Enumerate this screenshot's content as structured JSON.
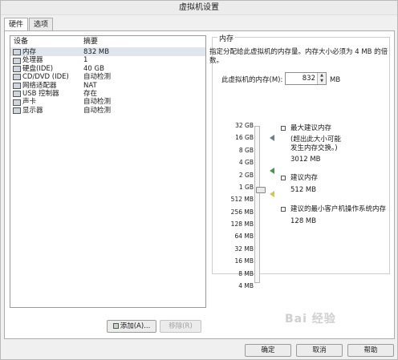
{
  "window": {
    "title": "虚拟机设置"
  },
  "tabs": [
    {
      "label": "硬件"
    },
    {
      "label": "选项"
    }
  ],
  "device_list": {
    "headers": {
      "device": "设备",
      "summary": "摘要"
    },
    "rows": [
      {
        "device": "内存",
        "summary": "832 MB",
        "icon": "memory-icon"
      },
      {
        "device": "处理器",
        "summary": "1",
        "icon": "processor-icon"
      },
      {
        "device": "硬盘(IDE)",
        "summary": "40 GB",
        "icon": "hard-disk-icon"
      },
      {
        "device": "CD/DVD (IDE)",
        "summary": "自动检测",
        "icon": "cd-dvd-icon"
      },
      {
        "device": "网络适配器",
        "summary": "NAT",
        "icon": "network-adapter-icon"
      },
      {
        "device": "USB 控制器",
        "summary": "存在",
        "icon": "usb-controller-icon"
      },
      {
        "device": "声卡",
        "summary": "自动检测",
        "icon": "sound-card-icon"
      },
      {
        "device": "显示器",
        "summary": "自动检测",
        "icon": "display-icon"
      }
    ],
    "add_button": "添加(A)...",
    "remove_button": "移除(R)"
  },
  "memory": {
    "group_title": "内存",
    "description": "指定分配给此虚拟机的内存量。内存大小必须为 4 MB 的倍数。",
    "field_label": "此虚拟机的内存(M):",
    "value": "832",
    "unit": "MB",
    "scale": [
      "32 GB",
      "16 GB",
      "8 GB",
      "4 GB",
      "2 GB",
      "1 GB",
      "512 MB",
      "256 MB",
      "128 MB",
      "64 MB",
      "32 MB",
      "16 MB",
      "8 MB",
      "4 MB"
    ],
    "max_recommended": {
      "title": "最大建议内存",
      "note_line1": "(超出此大小可能",
      "note_line2": "发生内存交换。)",
      "value": "3012 MB",
      "color": "#6a7f97"
    },
    "recommended": {
      "title": "建议内存",
      "value": "512 MB",
      "color": "#3f9f3f"
    },
    "guest_min": {
      "title": "建议的最小客户机操作系统内存",
      "value": "128 MB",
      "color": "#e0d84a"
    }
  },
  "buttons": {
    "ok": "确定",
    "cancel": "取消",
    "help": "帮助"
  },
  "watermark": "Bai 经验"
}
